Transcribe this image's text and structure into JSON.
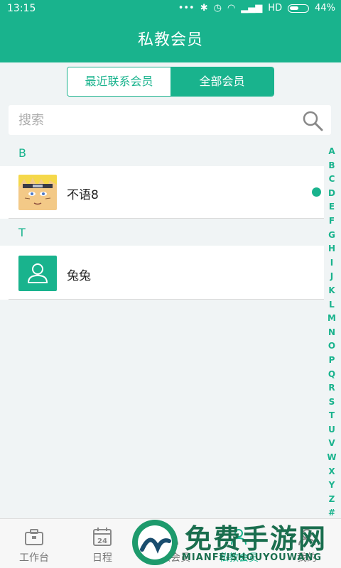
{
  "status": {
    "time": "13:15",
    "network": "HD",
    "battery": "44%"
  },
  "header": {
    "title": "私教会员"
  },
  "segment": {
    "tabs": [
      {
        "label": "最近联系会员",
        "active": false
      },
      {
        "label": "全部会员",
        "active": true
      }
    ]
  },
  "search": {
    "placeholder": "搜索",
    "value": ""
  },
  "sections": [
    {
      "letter": "B",
      "members": [
        {
          "name": "不语8",
          "online": true,
          "avatar": "photo"
        }
      ]
    },
    {
      "letter": "T",
      "members": [
        {
          "name": "兔兔",
          "online": false,
          "avatar": "default"
        }
      ]
    }
  ],
  "index_letters": [
    "A",
    "B",
    "C",
    "D",
    "E",
    "F",
    "G",
    "H",
    "I",
    "J",
    "K",
    "L",
    "M",
    "N",
    "O",
    "P",
    "Q",
    "R",
    "S",
    "T",
    "U",
    "V",
    "W",
    "X",
    "Y",
    "Z",
    "#"
  ],
  "tabbar": {
    "tabs": [
      {
        "label": "工作台",
        "icon": "briefcase-icon",
        "active": false
      },
      {
        "label": "日程",
        "icon": "calendar-icon",
        "date": "24",
        "active": false
      },
      {
        "label": "团教会员",
        "icon": "group-icon",
        "active": false
      },
      {
        "label": "私教会员",
        "icon": "member-icon",
        "active": true
      },
      {
        "label": "我的",
        "icon": "profile-icon",
        "active": false
      }
    ]
  },
  "watermark": {
    "title": "免费手游网",
    "subtitle": "MIANFEISHOUYOUWANG"
  },
  "colors": {
    "accent": "#19b38d",
    "background": "#f0f4f5"
  }
}
